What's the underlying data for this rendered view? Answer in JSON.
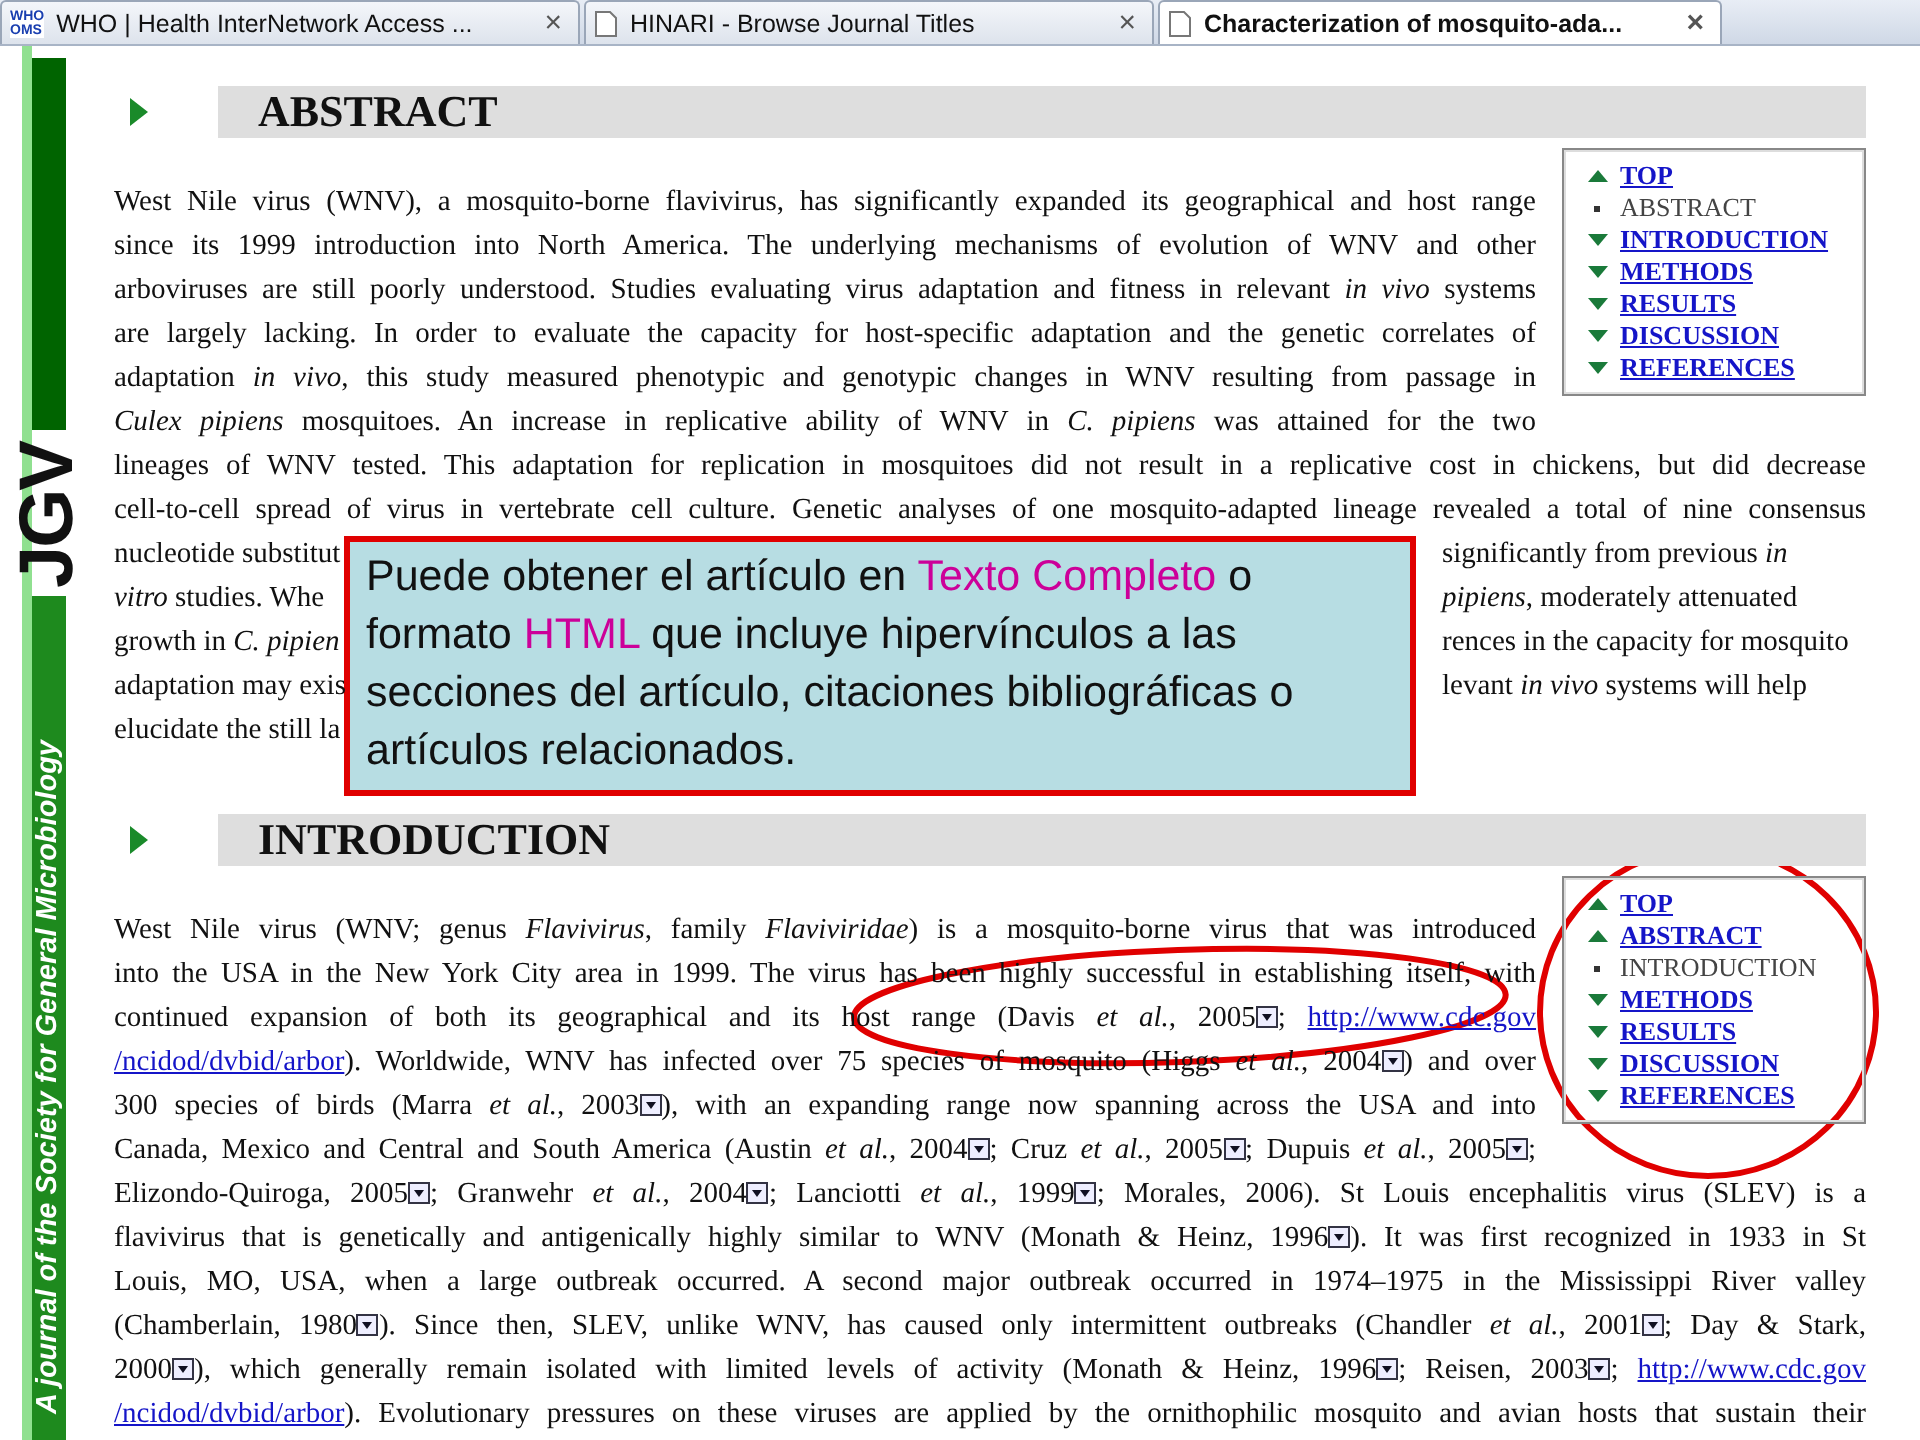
{
  "tabs": [
    {
      "title": "WHO | Health InterNetwork Access ...",
      "icon_text": [
        "WHO",
        "OMS"
      ],
      "selected": false,
      "close": "×"
    },
    {
      "title": "HINARI - Browse Journal Titles",
      "selected": false,
      "close": "×"
    },
    {
      "title": "Characterization of mosquito-ada...",
      "selected": true,
      "close": "×"
    }
  ],
  "journal_sidebar": {
    "logo": "JGV",
    "tagline": "A journal of the Society for General Microbiology"
  },
  "sections": [
    {
      "title": "ABSTRACT",
      "nav": [
        {
          "label": "TOP",
          "selected": false,
          "kind": "up"
        },
        {
          "label": "ABSTRACT",
          "selected": true
        },
        {
          "label": "INTRODUCTION",
          "selected": false,
          "kind": "down"
        },
        {
          "label": "METHODS",
          "selected": false,
          "kind": "down"
        },
        {
          "label": "RESULTS",
          "selected": false,
          "kind": "down"
        },
        {
          "label": "DISCUSSION",
          "selected": false,
          "kind": "down"
        },
        {
          "label": "REFERENCES",
          "selected": false,
          "kind": "down"
        }
      ],
      "lines": [
        {
          "kind": "full",
          "parts": [
            {
              "kind": "text",
              "text": "West Nile virus (WNV), a mosquito-borne flavivirus, has significantly expanded its geographical and host range"
            }
          ]
        },
        {
          "kind": "full",
          "parts": [
            {
              "kind": "text",
              "text": "since its 1999 introduction into North America. The underlying mechanisms of evolution of WNV and other"
            }
          ]
        },
        {
          "kind": "full",
          "parts": [
            {
              "kind": "text",
              "text": "arboviruses are still poorly understood. Studies evaluating virus adaptation and fitness in relevant *in vivo* systems"
            }
          ]
        },
        {
          "kind": "full",
          "parts": [
            {
              "kind": "text",
              "text": "are largely lacking. In order to evaluate the capacity for host-specific adaptation and the genetic correlates of"
            }
          ]
        },
        {
          "kind": "full",
          "parts": [
            {
              "kind": "text",
              "text": "adaptation *in vivo*, this study measured phenotypic and genotypic changes in WNV resulting from passage in"
            }
          ]
        },
        {
          "kind": "full",
          "parts": [
            {
              "kind": "text",
              "text": "*Culex pipiens* mosquitoes. An increase in replicative ability of WNV in *C. pipiens* was attained for the two"
            }
          ]
        },
        {
          "kind": "full",
          "parts": [
            {
              "kind": "text",
              "text": "lineages of WNV tested. This adaptation for replication in mosquitoes did not result in a replicative cost in chickens, but did decrease"
            }
          ]
        },
        {
          "kind": "full",
          "parts": [
            {
              "kind": "text",
              "text": "cell-to-cell spread of virus in vertebrate cell culture. Genetic analyses of one mosquito-adapted lineage revealed a total of nine consensus"
            }
          ]
        },
        {
          "kind": "split",
          "left": "nucleotide substitut",
          "right": "significantly from previous *in*"
        },
        {
          "kind": "split",
          "left": "*vitro* studies. Whe",
          "right": "*pipiens*, moderately attenuated"
        },
        {
          "kind": "split",
          "left": "growth in *C. pipien*",
          "right": "rences in the capacity for mosquito"
        },
        {
          "kind": "split",
          "left": "adaptation may exis",
          "right": "levant *in vivo* systems will help"
        },
        {
          "kind": "split",
          "left": "elucidate the still la"
        }
      ]
    },
    {
      "title": "INTRODUCTION",
      "nav": [
        {
          "label": "TOP",
          "selected": false,
          "kind": "up"
        },
        {
          "label": "ABSTRACT",
          "selected": false,
          "kind": "up"
        },
        {
          "label": "INTRODUCTION",
          "selected": true
        },
        {
          "label": "METHODS",
          "selected": false,
          "kind": "down"
        },
        {
          "label": "RESULTS",
          "selected": false,
          "kind": "down"
        },
        {
          "label": "DISCUSSION",
          "selected": false,
          "kind": "down"
        },
        {
          "label": "REFERENCES",
          "selected": false,
          "kind": "down"
        }
      ],
      "lines": [
        {
          "kind": "full",
          "parts": [
            {
              "kind": "text",
              "text": "West Nile virus (WNV; genus *Flavivirus*, family *Flaviviridae*) is a mosquito-borne virus that was introduced"
            }
          ]
        },
        {
          "kind": "full",
          "parts": [
            {
              "kind": "text",
              "text": "into the USA in the New York City area in 1999. The virus has been highly successful in establishing itself, with"
            }
          ]
        },
        {
          "kind": "full",
          "parts": [
            {
              "kind": "text",
              "text": "continued expansion of both its geographical and its host range (Davis *et al.*, 2005"
            },
            {
              "kind": "ref"
            },
            {
              "kind": "text",
              "text": "; "
            },
            {
              "kind": "link",
              "text": "http://www.cdc.gov"
            }
          ]
        },
        {
          "kind": "full",
          "parts": [
            {
              "kind": "link",
              "text": "/ncidod/dvbid/arbor"
            },
            {
              "kind": "text",
              "text": "). Worldwide, WNV has infected over 75 species of mosquito (Higgs *et al.*, 2004"
            },
            {
              "kind": "ref"
            },
            {
              "kind": "text",
              "text": ") and over"
            }
          ]
        },
        {
          "kind": "full",
          "parts": [
            {
              "kind": "text",
              "text": "300 species of birds (Marra *et al.*, 2003"
            },
            {
              "kind": "ref"
            },
            {
              "kind": "text",
              "text": "), with an expanding range now spanning across the USA and into"
            }
          ]
        },
        {
          "kind": "full",
          "parts": [
            {
              "kind": "text",
              "text": "Canada, Mexico and Central and South America (Austin *et al.*, 2004"
            },
            {
              "kind": "ref"
            },
            {
              "kind": "text",
              "text": "; Cruz *et al.*, 2005"
            },
            {
              "kind": "ref"
            },
            {
              "kind": "text",
              "text": "; Dupuis *et al.*, 2005"
            },
            {
              "kind": "ref"
            },
            {
              "kind": "text",
              "text": ";"
            }
          ]
        },
        {
          "kind": "full",
          "parts": [
            {
              "kind": "text",
              "text": "Elizondo-Quiroga, 2005"
            },
            {
              "kind": "ref"
            },
            {
              "kind": "text",
              "text": "; Granwehr *et al.*, 2004"
            },
            {
              "kind": "ref"
            },
            {
              "kind": "text",
              "text": "; Lanciotti *et al.*, 1999"
            },
            {
              "kind": "ref"
            },
            {
              "kind": "text",
              "text": "; Morales, 2006). St Louis encephalitis virus (SLEV) is a"
            }
          ]
        },
        {
          "kind": "full",
          "parts": [
            {
              "kind": "text",
              "text": "flavivirus that is genetically and antigenically highly similar to WNV (Monath & Heinz, 1996"
            },
            {
              "kind": "ref"
            },
            {
              "kind": "text",
              "text": "). It was first recognized in 1933 in St"
            }
          ]
        },
        {
          "kind": "full",
          "parts": [
            {
              "kind": "text",
              "text": "Louis, MO, USA, when a large outbreak occurred. A second major outbreak occurred in 1974–1975 in the Mississippi River valley"
            }
          ]
        },
        {
          "kind": "full",
          "parts": [
            {
              "kind": "text",
              "text": "(Chamberlain, 1980"
            },
            {
              "kind": "ref"
            },
            {
              "kind": "text",
              "text": "). Since then, SLEV, unlike WNV, has caused only intermittent outbreaks (Chandler *et al.*, 2001"
            },
            {
              "kind": "ref"
            },
            {
              "kind": "text",
              "text": "; Day & Stark,"
            }
          ]
        },
        {
          "kind": "full",
          "parts": [
            {
              "kind": "text",
              "text": "2000"
            },
            {
              "kind": "ref"
            },
            {
              "kind": "text",
              "text": "), which generally remain isolated with limited levels of activity (Monath & Heinz, 1996"
            },
            {
              "kind": "ref"
            },
            {
              "kind": "text",
              "text": "; Reisen, 2003"
            },
            {
              "kind": "ref"
            },
            {
              "kind": "text",
              "text": "; "
            },
            {
              "kind": "link",
              "text": "http://www.cdc.gov"
            }
          ]
        },
        {
          "kind": "full",
          "parts": [
            {
              "kind": "link",
              "text": "/ncidod/dvbid/arbor"
            },
            {
              "kind": "text",
              "text": "). Evolutionary pressures on these viruses are applied by the ornithophilic mosquito and avian hosts that sustain their"
            }
          ]
        }
      ]
    }
  ],
  "callout": {
    "parts": [
      {
        "text": "Puede obtener el artículo en ",
        "highlight": false
      },
      {
        "text": "Texto Completo",
        "highlight": true
      },
      {
        "text": " o formato ",
        "highlight": false
      },
      {
        "text": "HTML",
        "highlight": true
      },
      {
        "text": " que incluye hipervínculos a las secciones del artículo, citaciones bibliográficas o artículos relacionados.",
        "highlight": false
      }
    ]
  }
}
